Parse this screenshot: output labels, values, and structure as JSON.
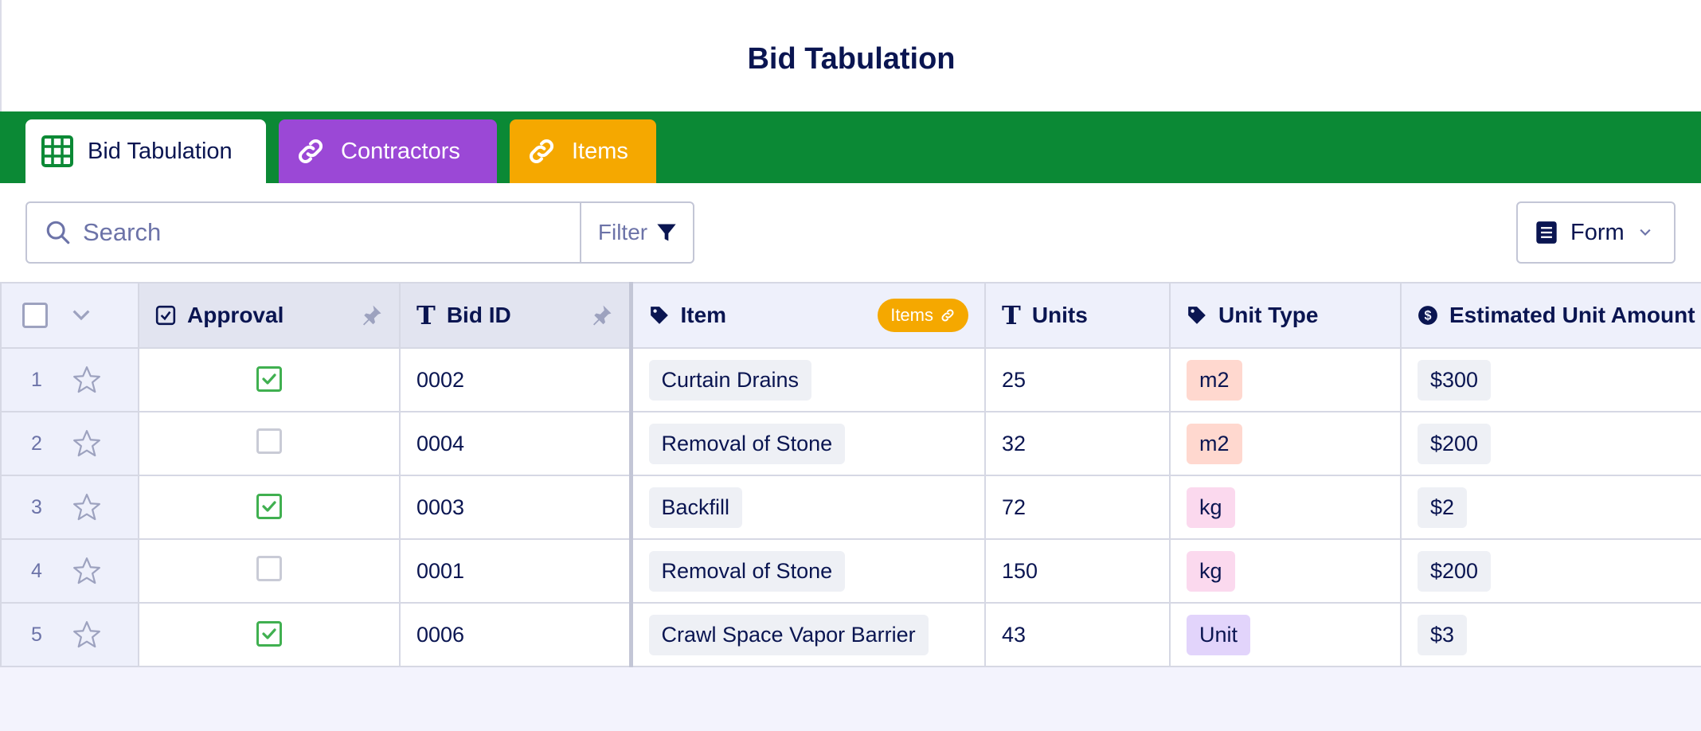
{
  "page": {
    "title": "Bid Tabulation"
  },
  "tabs": [
    {
      "label": "Bid Tabulation",
      "icon": "grid-icon",
      "color": "#ffffff"
    },
    {
      "label": "Contractors",
      "icon": "link-icon",
      "color": "#9b48d6"
    },
    {
      "label": "Items",
      "icon": "link-icon",
      "color": "#f5a800"
    }
  ],
  "toolbar": {
    "search_placeholder": "Search",
    "filter_label": "Filter",
    "form_label": "Form"
  },
  "table": {
    "columns": [
      {
        "label": "Approval",
        "icon": "checkbox-icon"
      },
      {
        "label": "Bid ID",
        "icon": "text-icon"
      },
      {
        "label": "Item",
        "icon": "tag-icon",
        "badge": "Items"
      },
      {
        "label": "Units",
        "icon": "text-icon"
      },
      {
        "label": "Unit Type",
        "icon": "tag-icon"
      },
      {
        "label": "Estimated Unit Amount",
        "icon": "currency-icon"
      }
    ],
    "rows": [
      {
        "num": "1",
        "approved": true,
        "bid_id": "0002",
        "item": "Curtain Drains",
        "units": "25",
        "unit_type": "m2",
        "amount": "$300"
      },
      {
        "num": "2",
        "approved": false,
        "bid_id": "0004",
        "item": "Removal of Stone",
        "units": "32",
        "unit_type": "m2",
        "amount": "$200"
      },
      {
        "num": "3",
        "approved": true,
        "bid_id": "0003",
        "item": "Backfill",
        "units": "72",
        "unit_type": "kg",
        "amount": "$2"
      },
      {
        "num": "4",
        "approved": false,
        "bid_id": "0001",
        "item": "Removal of Stone",
        "units": "150",
        "unit_type": "kg",
        "amount": "$200"
      },
      {
        "num": "5",
        "approved": true,
        "bid_id": "0006",
        "item": "Crawl Space Vapor Barrier",
        "units": "43",
        "unit_type": "Unit",
        "amount": "$3"
      }
    ]
  },
  "colors": {
    "tabbar": "#0b8935",
    "accent_green": "#40b050",
    "contractors": "#9b48d6",
    "items": "#f5a800"
  }
}
